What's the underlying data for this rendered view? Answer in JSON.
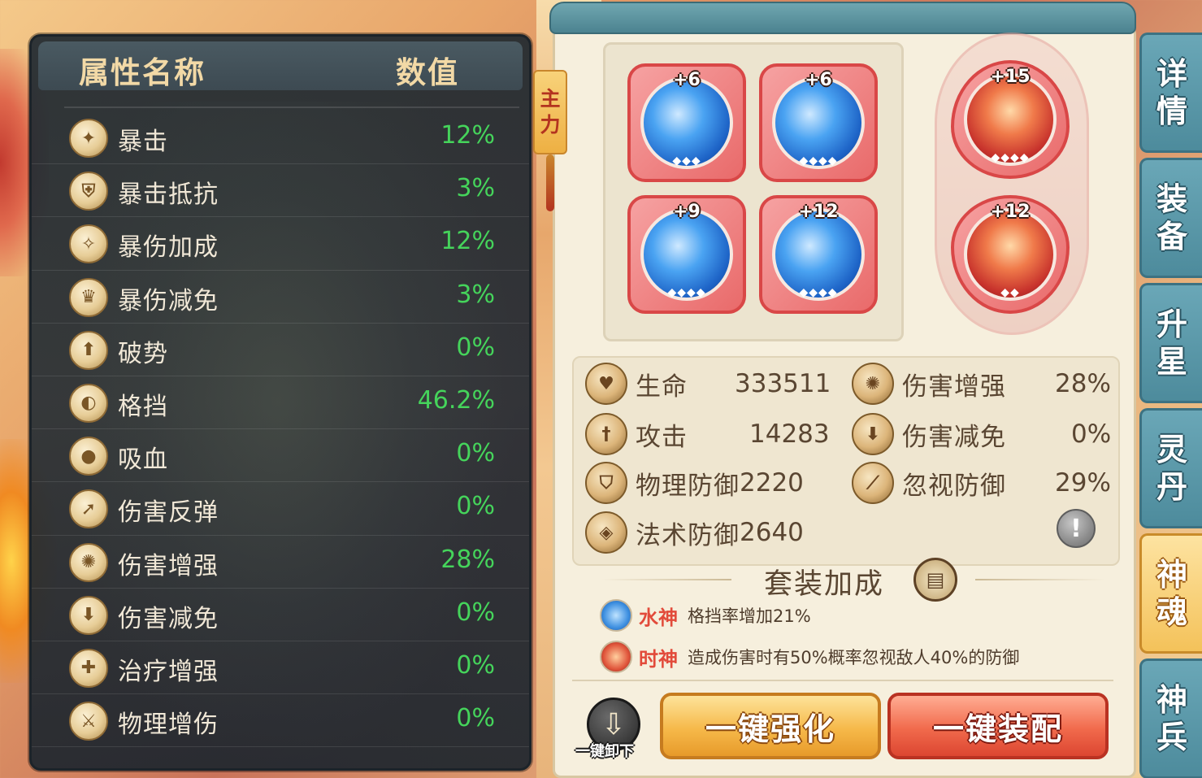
{
  "attributes": {
    "header_name": "属性名称",
    "header_value": "数值",
    "rows": [
      {
        "label": "暴击",
        "value": "12%",
        "icon": "crit-icon"
      },
      {
        "label": "暴击抵抗",
        "value": "3%",
        "icon": "crit-resist-icon"
      },
      {
        "label": "暴伤加成",
        "value": "12%",
        "icon": "crit-damage-icon"
      },
      {
        "label": "暴伤减免",
        "value": "3%",
        "icon": "crit-damage-reduce-icon"
      },
      {
        "label": "破势",
        "value": "0%",
        "icon": "break-icon"
      },
      {
        "label": "格挡",
        "value": "46.2%",
        "icon": "block-icon"
      },
      {
        "label": "吸血",
        "value": "0%",
        "icon": "lifesteal-icon"
      },
      {
        "label": "伤害反弹",
        "value": "0%",
        "icon": "reflect-icon"
      },
      {
        "label": "伤害增强",
        "value": "28%",
        "icon": "damage-boost-icon"
      },
      {
        "label": "伤害减免",
        "value": "0%",
        "icon": "damage-reduce-icon"
      },
      {
        "label": "治疗增强",
        "value": "0%",
        "icon": "heal-boost-icon"
      },
      {
        "label": "物理增伤",
        "value": "0%",
        "icon": "physical-boost-icon"
      }
    ]
  },
  "main_tag": [
    "主",
    "力"
  ],
  "slots": [
    {
      "level": "+6",
      "stars": "◆◆◆",
      "type": "water"
    },
    {
      "level": "+6",
      "stars": "◆◆◆◆",
      "type": "water"
    },
    {
      "level": "+9",
      "stars": "◆◆◆◆",
      "type": "water"
    },
    {
      "level": "+12",
      "stars": "◆◆◆◆",
      "type": "water"
    },
    {
      "level": "+15",
      "stars": "◆◆◆◆",
      "type": "fire"
    },
    {
      "level": "+12",
      "stars": "◆◆",
      "type": "fire"
    }
  ],
  "stats": {
    "hp_label": "生命",
    "hp_value": "333511",
    "atk_label": "攻击",
    "atk_value": "14283",
    "pdef_label": "物理防御",
    "pdef_value": "2220",
    "mdef_label": "法术防御",
    "mdef_value": "2640",
    "dmgup_label": "伤害增强",
    "dmgup_value": "28%",
    "dmgdown_label": "伤害减免",
    "dmgdown_value": "0%",
    "ignore_label": "忽视防御",
    "ignore_value": "29%"
  },
  "set_bonus": {
    "title": "套装加成",
    "items": [
      {
        "name": "水神",
        "text": "格挡率增加21%"
      },
      {
        "name": "时神",
        "text": "造成伤害时有50%概率忽视敌人40%的防御"
      }
    ]
  },
  "buttons": {
    "unload": "一键卸下",
    "strengthen": "一键强化",
    "equip": "一键装配"
  },
  "tabs": [
    {
      "label": [
        "详",
        "情"
      ],
      "active": false
    },
    {
      "label": [
        "装",
        "备"
      ],
      "active": false
    },
    {
      "label": [
        "升",
        "星"
      ],
      "active": false
    },
    {
      "label": [
        "灵",
        "丹"
      ],
      "active": false
    },
    {
      "label": [
        "神",
        "魂"
      ],
      "active": true
    },
    {
      "label": [
        "神",
        "兵"
      ],
      "active": false
    }
  ]
}
